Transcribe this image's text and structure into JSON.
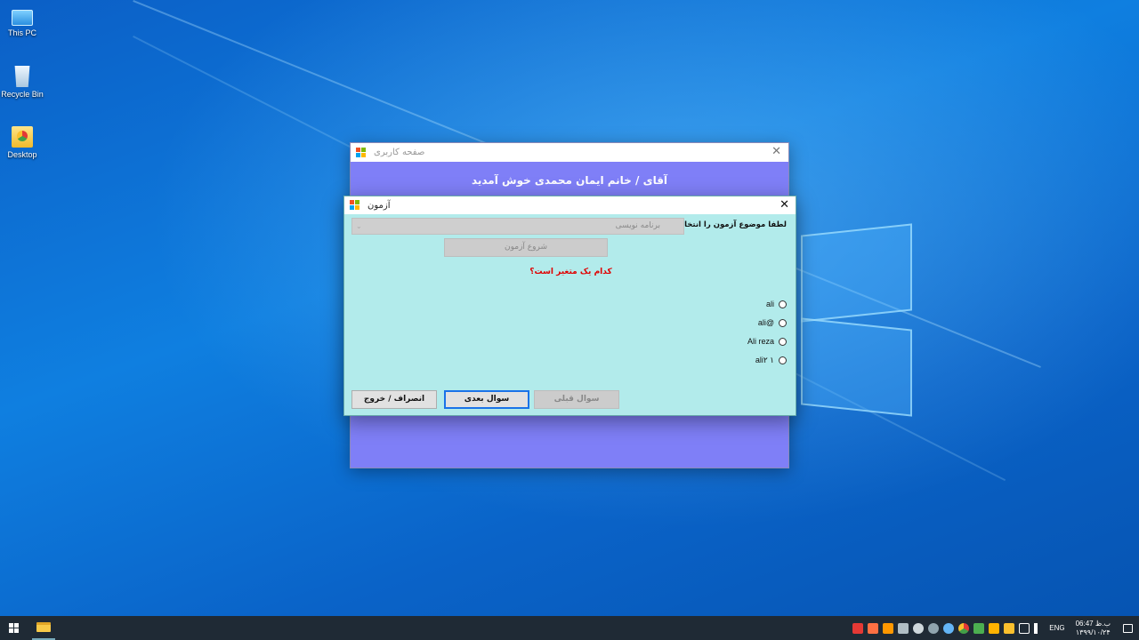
{
  "desktop": {
    "icons": [
      {
        "label": "This PC",
        "icon": "computer-icon"
      },
      {
        "label": "Recycle Bin",
        "icon": "recycle-bin-icon"
      },
      {
        "label": "Desktop",
        "icon": "folder-icon"
      }
    ]
  },
  "user_window": {
    "title": "صفحه کاربری",
    "welcome": "آقای / خانم ایمان محمدی خوش آمدید"
  },
  "quiz_window": {
    "title": "آزمون",
    "topic_label": "لطفا موضوع آزمون را انتخاب کنید:",
    "topic_selected": "برنامه نویسی",
    "start_button": "شروع آزمون",
    "question": "کدام یک متغیر  است؟",
    "options": [
      "ali",
      "ali@",
      "Ali reza",
      "ali۲ ۱"
    ],
    "prev_button": "سوال قبلی",
    "next_button": "سوال بعدی",
    "exit_button": "انصراف / خروج"
  },
  "taskbar": {
    "language": "ENG",
    "time": "06:47 ب.ظ",
    "date": "۱۳۹۹/۱۰/۲۴",
    "tray_icons": [
      "app-red-icon",
      "app-orange-icon",
      "app-orange2-icon",
      "pen-icon",
      "moon-icon",
      "search-circle-icon",
      "globe-icon",
      "chrome-icon",
      "refresh-icon",
      "key-icon",
      "folder-icon",
      "network-icon",
      "speaker-icon"
    ]
  },
  "colors": {
    "user_window_bg": "#7f7ff7",
    "quiz_window_bg": "#b2ebeb",
    "question_color": "#e00000",
    "taskbar_bg": "#1f2a35"
  }
}
